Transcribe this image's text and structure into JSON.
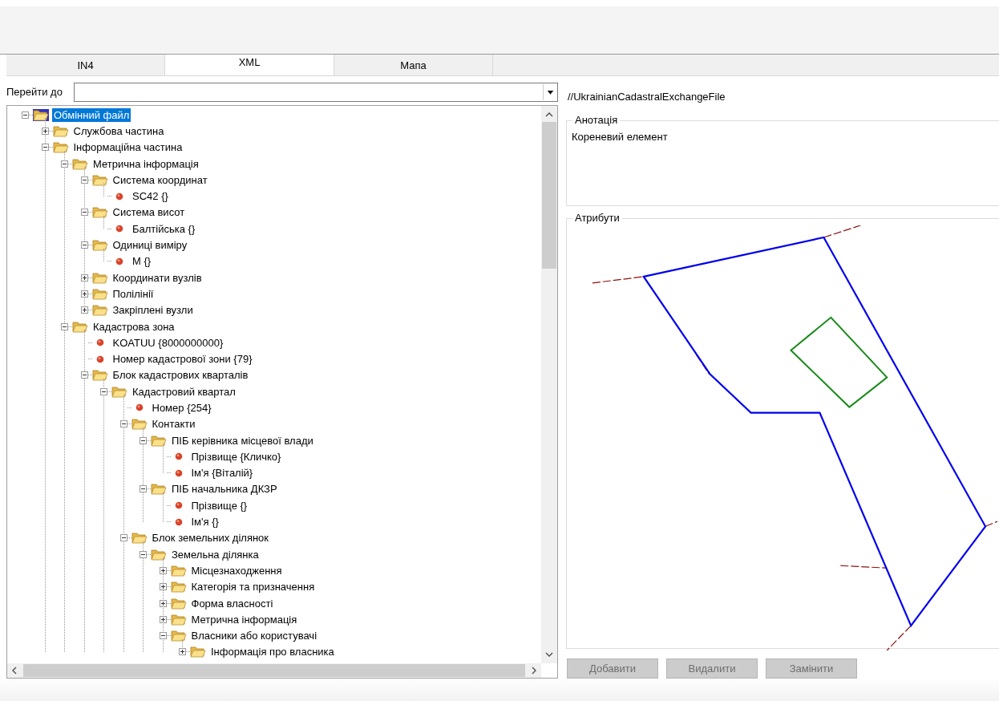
{
  "tabs": [
    {
      "label": "IN4",
      "selected": false
    },
    {
      "label": "XML",
      "selected": true
    },
    {
      "label": "Мапа",
      "selected": false
    }
  ],
  "goto": {
    "label": "Перейти до"
  },
  "tree": [
    {
      "label": "Обмінний файл",
      "kind": "folder",
      "expanded": true,
      "selected": true,
      "children": [
        {
          "label": "Службова частина",
          "kind": "folder",
          "expanded": false,
          "selected": false
        },
        {
          "label": "Інформаційна частина",
          "kind": "folder",
          "expanded": true,
          "selected": false,
          "children": [
            {
              "label": "Метрична інформація",
              "kind": "folder",
              "expanded": true,
              "selected": false,
              "children": [
                {
                  "label": "Система координат",
                  "kind": "folder",
                  "expanded": true,
                  "selected": false,
                  "children": [
                    {
                      "label": "SC42 {}",
                      "kind": "leaf",
                      "selected": false
                    }
                  ]
                },
                {
                  "label": "Система висот",
                  "kind": "folder",
                  "expanded": true,
                  "selected": false,
                  "children": [
                    {
                      "label": "Балтійська {}",
                      "kind": "leaf",
                      "selected": false
                    }
                  ]
                },
                {
                  "label": "Одиниці виміру",
                  "kind": "folder",
                  "expanded": true,
                  "selected": false,
                  "children": [
                    {
                      "label": "M {}",
                      "kind": "leaf",
                      "selected": false
                    }
                  ]
                },
                {
                  "label": "Координати вузлів",
                  "kind": "folder",
                  "expanded": false,
                  "selected": false
                },
                {
                  "label": "Полілінії",
                  "kind": "folder",
                  "expanded": false,
                  "selected": false
                },
                {
                  "label": "Закріплені вузли",
                  "kind": "folder",
                  "expanded": false,
                  "selected": false
                }
              ]
            },
            {
              "label": "Кадастрова зона",
              "kind": "folder",
              "expanded": true,
              "selected": false,
              "children": [
                {
                  "label": "KOATUU {8000000000}",
                  "kind": "leaf",
                  "selected": false
                },
                {
                  "label": "Номер кадастрової зони {79}",
                  "kind": "leaf",
                  "selected": false
                },
                {
                  "label": "Блок кадастрових кварталів",
                  "kind": "folder",
                  "expanded": true,
                  "selected": false,
                  "children": [
                    {
                      "label": "Кадастровий квартал",
                      "kind": "folder",
                      "expanded": true,
                      "selected": false,
                      "children": [
                        {
                          "label": "Номер {254}",
                          "kind": "leaf",
                          "selected": false
                        },
                        {
                          "label": "Контакти",
                          "kind": "folder",
                          "expanded": true,
                          "selected": false,
                          "children": [
                            {
                              "label": "ПІБ керівника місцевої влади",
                              "kind": "folder",
                              "expanded": true,
                              "selected": false,
                              "children": [
                                {
                                  "label": "Прізвище {Кличко}",
                                  "kind": "leaf",
                                  "selected": false
                                },
                                {
                                  "label": "Ім'я {Віталій}",
                                  "kind": "leaf",
                                  "selected": false
                                }
                              ]
                            },
                            {
                              "label": "ПІБ начальника ДКЗР",
                              "kind": "folder",
                              "expanded": true,
                              "selected": false,
                              "children": [
                                {
                                  "label": "Прізвище {}",
                                  "kind": "leaf",
                                  "selected": false
                                },
                                {
                                  "label": "Ім'я {}",
                                  "kind": "leaf",
                                  "selected": false
                                }
                              ]
                            }
                          ]
                        },
                        {
                          "label": "Блок земельних ділянок",
                          "kind": "folder",
                          "expanded": true,
                          "selected": false,
                          "children": [
                            {
                              "label": "Земельна ділянка",
                              "kind": "folder",
                              "expanded": true,
                              "selected": false,
                              "children": [
                                {
                                  "label": "Місцезнаходження",
                                  "kind": "folder",
                                  "expanded": false,
                                  "selected": false
                                },
                                {
                                  "label": "Категорія та призначення",
                                  "kind": "folder",
                                  "expanded": false,
                                  "selected": false
                                },
                                {
                                  "label": "Форма власності",
                                  "kind": "folder",
                                  "expanded": false,
                                  "selected": false
                                },
                                {
                                  "label": "Метрична інформація",
                                  "kind": "folder",
                                  "expanded": false,
                                  "selected": false
                                },
                                {
                                  "label": "Власники або користувачі",
                                  "kind": "folder",
                                  "expanded": true,
                                  "selected": false,
                                  "children": [
                                    {
                                      "label": "Інформація про власника",
                                      "kind": "folder",
                                      "expanded": false,
                                      "selected": false
                                    }
                                  ]
                                }
                              ]
                            }
                          ]
                        }
                      ]
                    }
                  ]
                }
              ]
            }
          ]
        }
      ]
    }
  ],
  "path": "//UkrainianCadastralExchangeFile",
  "annotation": {
    "title": "Анотація",
    "text": "Кореневий елемент"
  },
  "attributes": {
    "title": "Атрибути"
  },
  "buttons": [
    {
      "label": "Добавити",
      "disabled": true
    },
    {
      "label": "Видалити",
      "disabled": true
    },
    {
      "label": "Замінити",
      "disabled": true
    }
  ]
}
